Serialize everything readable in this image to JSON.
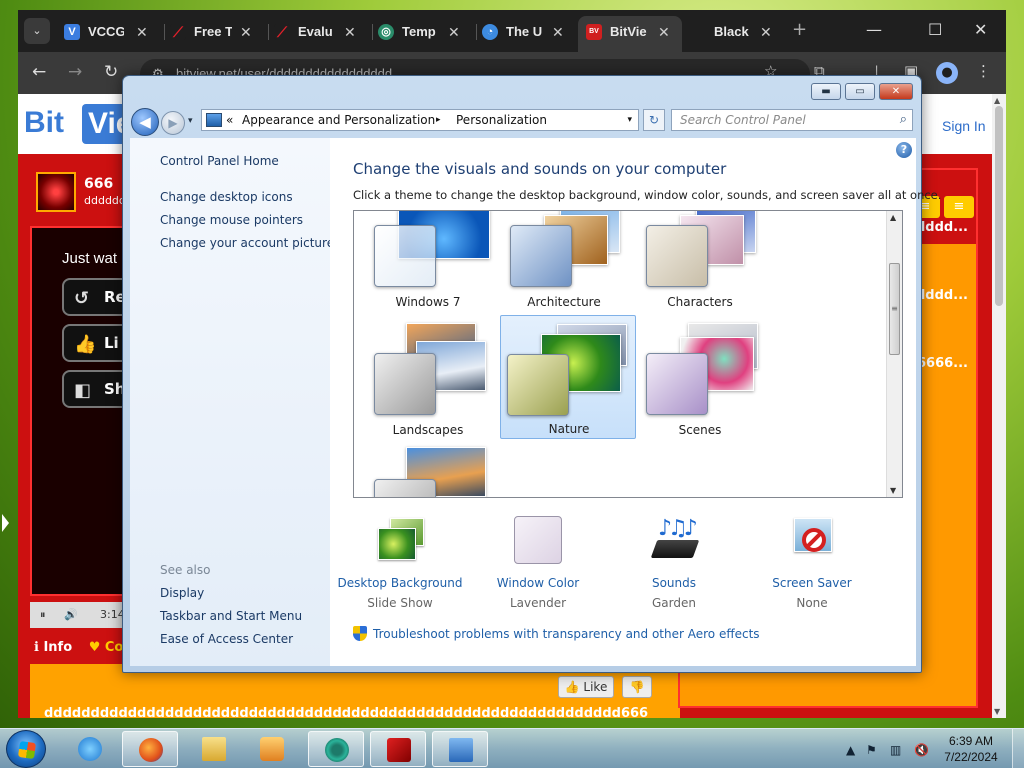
{
  "browser": {
    "tabs": [
      {
        "label": "VCCG",
        "favicon": "V"
      },
      {
        "label": "Free T",
        "favicon": "slash"
      },
      {
        "label": "Evalu",
        "favicon": "slash"
      },
      {
        "label": "Temp",
        "favicon": "globe"
      },
      {
        "label": "The U",
        "favicon": "chat"
      },
      {
        "label": "BitVie",
        "favicon": "BV"
      },
      {
        "label": "Black",
        "favicon": ""
      }
    ],
    "menu_glyph": "⌄",
    "tab_close_glyph": "✕",
    "new_tab_glyph": "+",
    "url": "bitview.net/user/ddddddddddddddddd",
    "window_controls": {
      "minimize": "—",
      "maximize": "☐",
      "close": "✕"
    },
    "nav": {
      "back": "←",
      "forward": "→",
      "reload": "↻",
      "site_info": "⚙"
    },
    "toolbar_icons": {
      "star": "☆",
      "extensions": "⧉",
      "pin": "⊥",
      "sidepanel": "▣",
      "profile": "●",
      "menu": "⋮"
    }
  },
  "bitview": {
    "logo_bit": "Bit",
    "logo_view": "View",
    "sign_in": "Sign In",
    "channel_name": "666",
    "channel_sub": "dddddd",
    "just_watched": "Just wat",
    "buttons": [
      {
        "label": "Re",
        "icon": "↺"
      },
      {
        "label": "Li",
        "icon": "👍"
      },
      {
        "label": "Sh",
        "icon": "◧"
      }
    ],
    "player_time": "3:14",
    "player_icons": {
      "pause": "⏸",
      "volume": "🔊"
    },
    "info_tab": "ℹ Info",
    "comments_tab": "♥ Co",
    "like_label": "👍 Like",
    "dislike_label": "👎",
    "footer_text": "dddddddddddddddddddddddddddddddddddddddddddddddddddddddddddddd666",
    "right_texts": [
      "dddd...",
      "dddd...",
      "6666..."
    ],
    "yellow_buttons": [
      "≡",
      "≡"
    ]
  },
  "control_panel": {
    "title_buttons": {
      "minimize": "▬",
      "maximize": "▭",
      "close": "✕"
    },
    "back_glyph": "◀",
    "forward_glyph": "▶",
    "recent_glyph": "▾",
    "address_glyphs": {
      "overflow": "«",
      "separator": "▸",
      "dropdown": "▾"
    },
    "address": {
      "part1": "Appearance and Personalization",
      "part2": "Personalization"
    },
    "refresh_glyph": "↻",
    "search_placeholder": "Search Control Panel",
    "search_glyph": "⌕",
    "help_glyph": "?",
    "left_links": [
      "Control Panel Home",
      "Change desktop icons",
      "Change mouse pointers",
      "Change your account picture"
    ],
    "see_also_label": "See also",
    "see_also_links": [
      "Display",
      "Taskbar and Start Menu",
      "Ease of Access Center"
    ],
    "heading": "Change the visuals and sounds on your computer",
    "description": "Click a theme to change the desktop background, window color, sounds, and screen saver all at once.",
    "themes": [
      "Windows 7",
      "Architecture",
      "Characters",
      "Landscapes",
      "Nature",
      "Scenes"
    ],
    "selected_theme": "Nature",
    "scroll_glyphs": {
      "up": "▲",
      "grip": "≡",
      "down": "▼"
    },
    "bottom": [
      {
        "link": "Desktop Background",
        "value": "Slide Show",
        "icon": "desktop-background-icon"
      },
      {
        "link": "Window Color",
        "value": "Lavender",
        "icon": "window-color-icon"
      },
      {
        "link": "Sounds",
        "value": "Garden",
        "icon": "sounds-icon"
      },
      {
        "link": "Screen Saver",
        "value": "None",
        "icon": "screen-saver-icon"
      }
    ],
    "troubleshoot": "Troubleshoot problems with transparency and other Aero effects"
  },
  "taskbar": {
    "apps": [
      "internet-explorer",
      "firefox",
      "file-explorer",
      "media-player",
      "chrome",
      "kaspersky",
      "control-panel"
    ],
    "tray_icons": {
      "show_hidden": "▲",
      "flag": "⚑",
      "network": "▥",
      "volume": "🔇"
    },
    "time": "6:39 AM",
    "date": "7/22/2024"
  }
}
